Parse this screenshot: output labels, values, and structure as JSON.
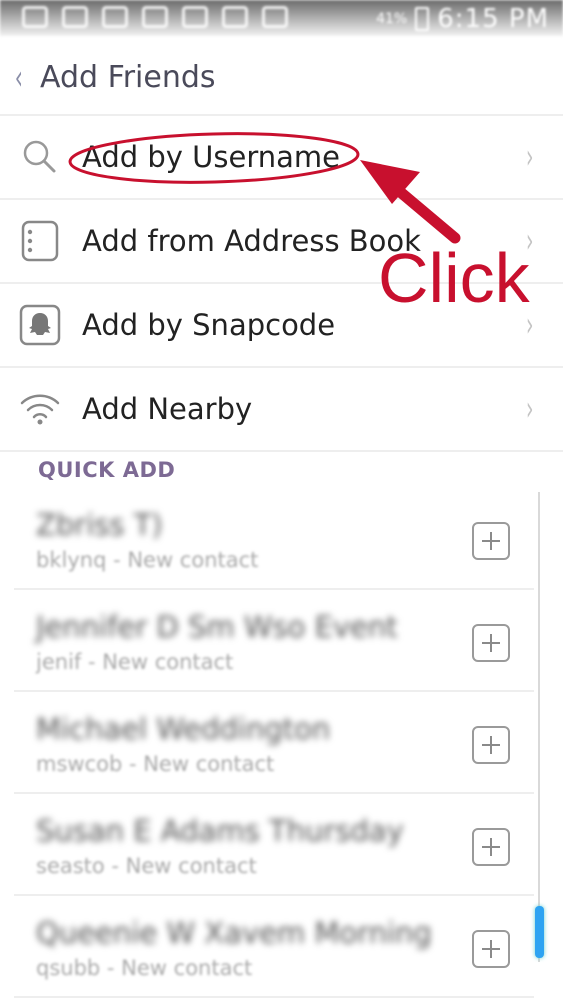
{
  "status_bar": {
    "battery": "41%",
    "time": "6:15 PM"
  },
  "header": {
    "back_glyph": "‹",
    "title": "Add Friends"
  },
  "menu": {
    "items": [
      {
        "label": "Add by Username",
        "icon": "search-icon"
      },
      {
        "label": "Add from Address Book",
        "icon": "address-book-icon"
      },
      {
        "label": "Add by Snapcode",
        "icon": "snapcode-ghost-icon"
      },
      {
        "label": "Add Nearby",
        "icon": "wifi-icon"
      }
    ],
    "chevron": "›"
  },
  "quick_add": {
    "heading": "QUICK ADD",
    "contacts": [
      {
        "name": "Zbriss T)",
        "sub": "bklynq - New contact"
      },
      {
        "name": "Jennifer D Sm Wso Event",
        "sub": "jenif - New contact"
      },
      {
        "name": "Michael Weddington",
        "sub": "mswcob - New contact"
      },
      {
        "name": "Susan E Adams Thursday",
        "sub": "seasto - New contact"
      },
      {
        "name": "Queenie W Xavem Morning",
        "sub": "qsubb - New contact"
      }
    ]
  },
  "annotation": {
    "text": "Click",
    "color": "#c8102e"
  },
  "colors": {
    "section_heading": "#7d6a94",
    "scroll_thumb": "#2ea3f2"
  }
}
